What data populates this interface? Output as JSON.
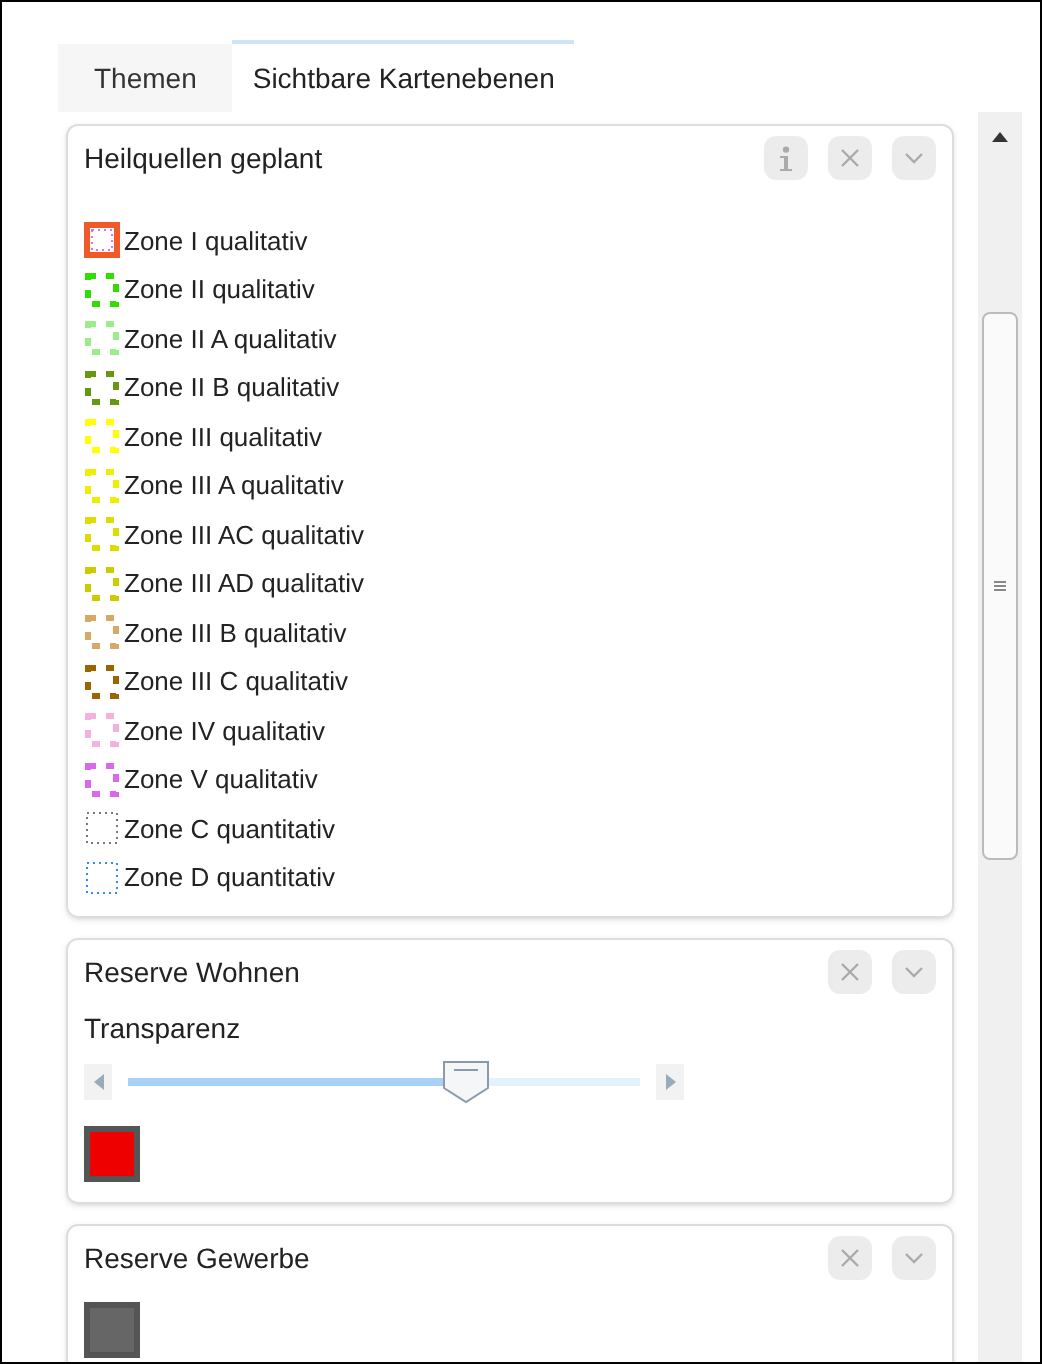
{
  "tabs": [
    {
      "label": "Themen",
      "selected": false
    },
    {
      "label": "Sichtbare Kartenebenen",
      "selected": true
    }
  ],
  "layers": [
    {
      "title": "Heilquellen geplant",
      "info": true,
      "legend": [
        {
          "label": "Zone I qualitativ",
          "kind": "solid",
          "color": "#f05a28"
        },
        {
          "label": "Zone II qualitativ",
          "kind": "dashed",
          "color": "#33dd00"
        },
        {
          "label": "Zone II A qualitativ",
          "kind": "dashed",
          "color": "#99ee88"
        },
        {
          "label": "Zone II B qualitativ",
          "kind": "dashed",
          "color": "#669911"
        },
        {
          "label": "Zone III qualitativ",
          "kind": "dashed",
          "color": "#ffff00"
        },
        {
          "label": "Zone III A qualitativ",
          "kind": "dashed",
          "color": "#eeee00"
        },
        {
          "label": "Zone III AC qualitativ",
          "kind": "dashed",
          "color": "#dddd00"
        },
        {
          "label": "Zone III AD qualitativ",
          "kind": "dashed",
          "color": "#cccc00"
        },
        {
          "label": "Zone III B qualitativ",
          "kind": "dashed",
          "color": "#d4aa66"
        },
        {
          "label": "Zone III C qualitativ",
          "kind": "dashed",
          "color": "#996600"
        },
        {
          "label": "Zone IV qualitativ",
          "kind": "dashed",
          "color": "#f5b0dd"
        },
        {
          "label": "Zone V qualitativ",
          "kind": "dashed",
          "color": "#dd66ee"
        },
        {
          "label": "Zone C quantitativ",
          "kind": "dotted",
          "color": "#777777"
        },
        {
          "label": "Zone D quantitativ",
          "kind": "dotted",
          "color": "#3388ff"
        }
      ]
    },
    {
      "title": "Reserve Wohnen",
      "info": false,
      "transparency": {
        "label": "Transparenz",
        "level": 0.66
      },
      "color": "#ee0000"
    },
    {
      "title": "Reserve Gewerbe",
      "info": false,
      "color": "#666666"
    }
  ]
}
